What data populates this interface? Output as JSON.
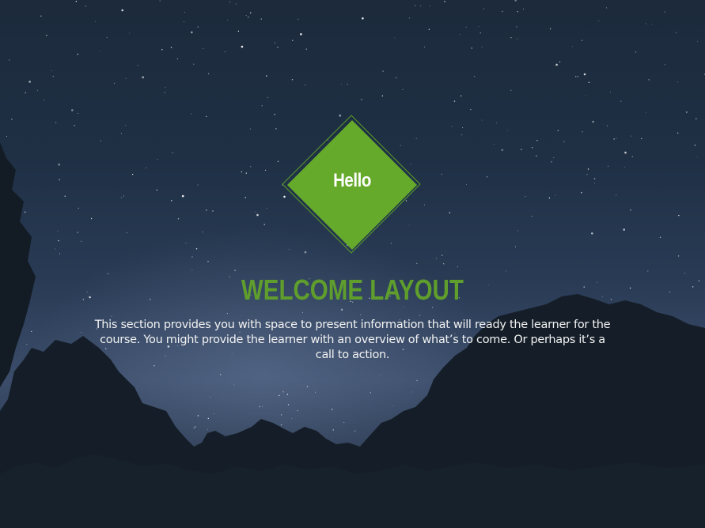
{
  "badge": {
    "label": "Hello",
    "color": "#66aa2b"
  },
  "welcome": {
    "title": "WELCOME LAYOUT",
    "body": "This section provides you with space to present information that will ready the learner for the course. You might provide the learner with an overview of what’s to come. Or perhaps it’s a call to action."
  },
  "background": {
    "description_icon": "night-sky-background"
  }
}
